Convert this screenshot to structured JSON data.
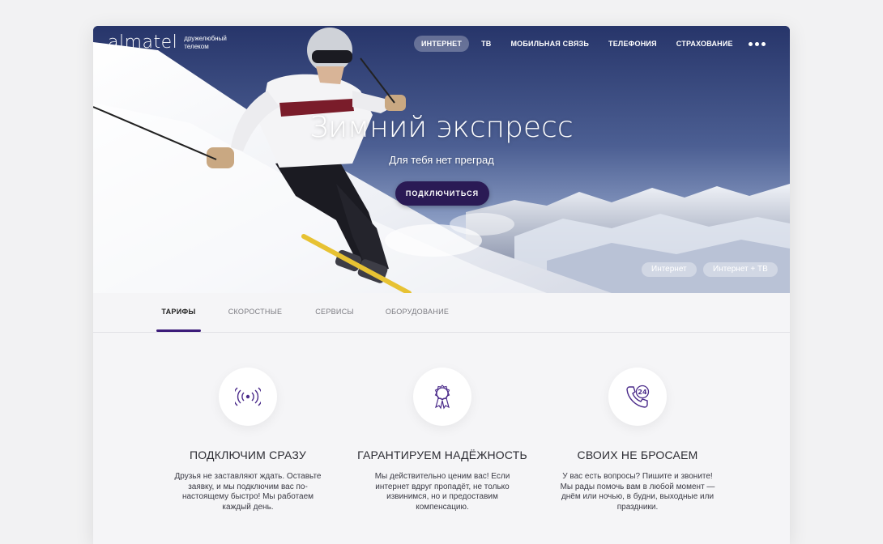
{
  "brand": {
    "logo": "almatel",
    "tagline": "дружелюбный телеком"
  },
  "nav": {
    "items": [
      {
        "label": "ИНТЕРНЕТ",
        "active": true
      },
      {
        "label": "ТВ",
        "active": false
      },
      {
        "label": "МОБИЛЬНАЯ СВЯЗЬ",
        "active": false
      },
      {
        "label": "ТЕЛЕФОНИЯ",
        "active": false
      },
      {
        "label": "СТРАХОВАНИЕ",
        "active": false
      }
    ],
    "more_icon": "more-dots-icon"
  },
  "hero": {
    "title": "Зимний экспресс",
    "subtitle": "Для тебя нет преград",
    "cta_label": "ПОДКЛЮЧИТЬСЯ",
    "pills": [
      "Интернет",
      "Интернет + ТВ"
    ]
  },
  "tabs": [
    {
      "label": "ТАРИФЫ",
      "active": true
    },
    {
      "label": "СКОРОСТНЫЕ",
      "active": false
    },
    {
      "label": "СЕРВИСЫ",
      "active": false
    },
    {
      "label": "ОБОРУДОВАНИЕ",
      "active": false
    }
  ],
  "features": [
    {
      "icon": "wifi-signal-icon",
      "title": "ПОДКЛЮЧИМ СРАЗУ",
      "text": "Друзья не заставляют ждать. Оставьте заявку, и мы подключим вас по-настоящему быстро! Мы работаем каждый день."
    },
    {
      "icon": "award-ribbon-icon",
      "title": "ГАРАНТИРУЕМ НАДЁЖНОСТЬ",
      "text": "Мы действительно ценим вас! Если интернет вдруг пропадёт, не только извинимся, но и предоставим компенсацию."
    },
    {
      "icon": "phone-24-icon",
      "title": "СВОИХ НЕ БРОСАЕМ",
      "text": "У вас есть вопросы? Пишите и звоните! Мы рады помочь вам в любой момент — днём или ночью, в будни, выходные или праздники."
    }
  ],
  "colors": {
    "accent": "#3c1c7a",
    "cta": "#2a1a55",
    "icon": "#4a2a8a"
  }
}
